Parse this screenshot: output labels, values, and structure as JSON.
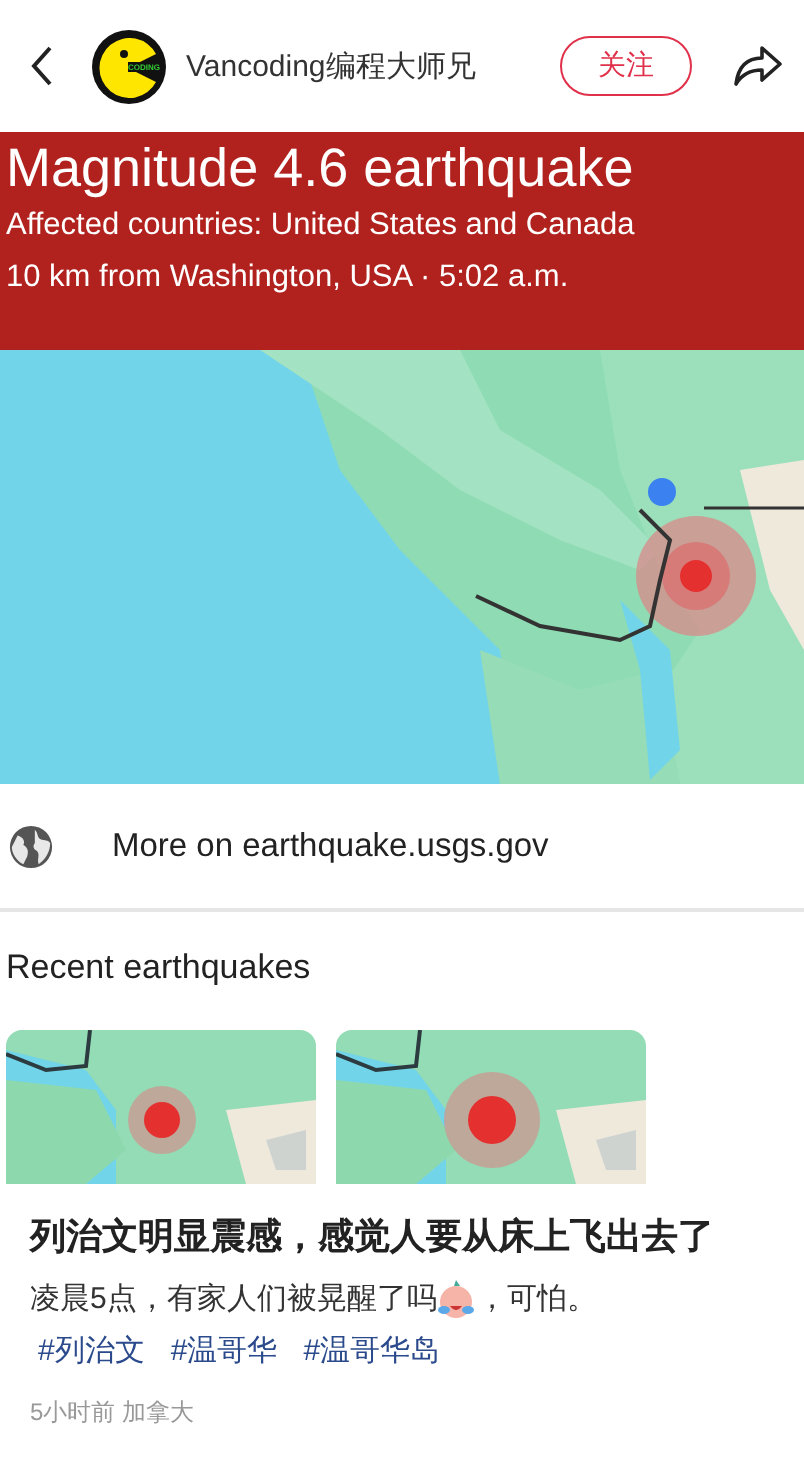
{
  "header": {
    "avatar_text": "CODING",
    "author": "Vancoding编程大师兄",
    "follow_button": "关注"
  },
  "alert": {
    "title": "Magnitude 4.6 earthquake",
    "lines": [
      "Affected countries: United States and Canada",
      "10 km from Washington, USA · 5:02 a.m."
    ]
  },
  "link": {
    "label": "More on earthquake.usgs.gov"
  },
  "recent": {
    "title": "Recent earthquakes"
  },
  "post": {
    "title": "列治文明显震感，感觉人要从床上飞出去了",
    "body_before": "凌晨5点，有家人们被晃醒了吗",
    "body_after": "，可怕。",
    "tags": [
      "#列治文",
      "#温哥华",
      "#温哥华岛"
    ],
    "meta": "5小时前 加拿大"
  }
}
